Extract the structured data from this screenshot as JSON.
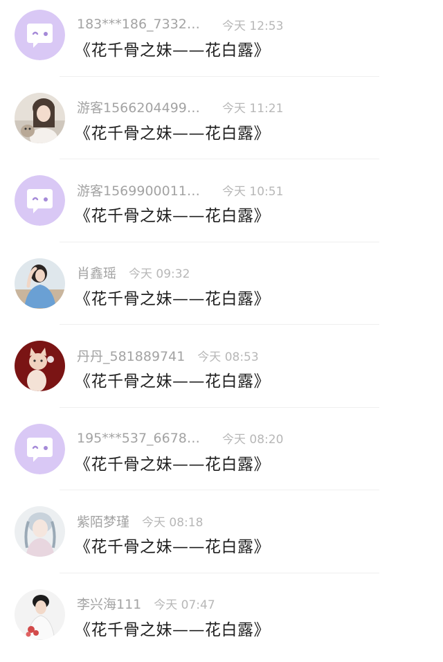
{
  "comments": [
    {
      "username": "183***186_7332…",
      "time": "今天 12:53",
      "text": "《花千骨之妹——花白露》",
      "avatar": "chat-bubble-icon"
    },
    {
      "username": "游客1566204499…",
      "time": "今天 11:21",
      "text": "《花千骨之妹——花白露》",
      "avatar": "user-photo"
    },
    {
      "username": "游客1569900011…",
      "time": "今天 10:51",
      "text": "《花千骨之妹——花白露》",
      "avatar": "chat-bubble-icon"
    },
    {
      "username": "肖鑫瑶",
      "time": "今天 09:32",
      "text": "《花千骨之妹——花白露》",
      "avatar": "user-photo"
    },
    {
      "username": "丹丹_581889741",
      "time": "今天 08:53",
      "text": "《花千骨之妹——花白露》",
      "avatar": "user-photo"
    },
    {
      "username": "195***537_6678…",
      "time": "今天 08:20",
      "text": "《花千骨之妹——花白露》",
      "avatar": "chat-bubble-icon"
    },
    {
      "username": "紫陌梦瑾",
      "time": "今天 08:18",
      "text": "《花千骨之妹——花白露》",
      "avatar": "user-photo"
    },
    {
      "username": "李兴海111",
      "time": "今天 07:47",
      "text": "《花千骨之妹——花白露》",
      "avatar": "user-photo"
    }
  ],
  "colors": {
    "default_avatar_bg": "#d9c8f5",
    "username": "#a3a3a3",
    "time": "#b7b7b7",
    "message": "#1f1f1f"
  }
}
